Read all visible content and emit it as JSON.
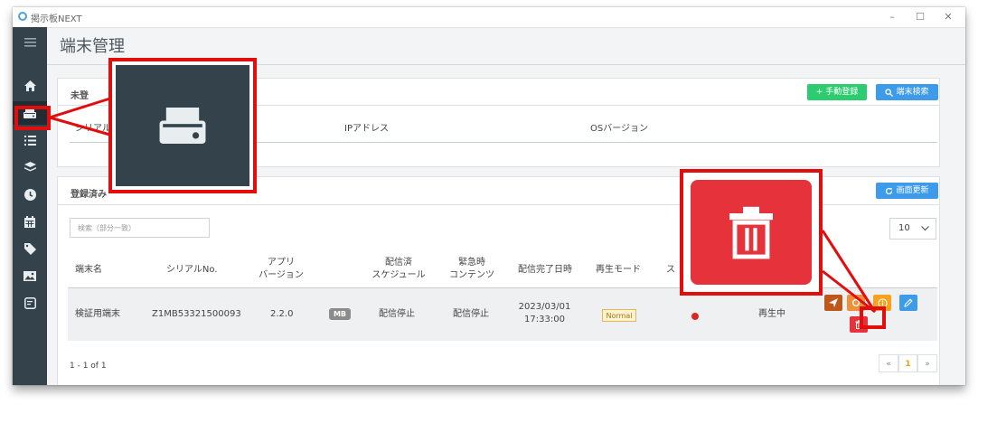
{
  "window": {
    "app_title": "掲示板NEXT",
    "controls": [
      "–",
      "☐",
      "✕"
    ]
  },
  "sidebar": {
    "items": [
      {
        "icon": "menu-icon",
        "active": false
      },
      {
        "icon": "home-icon",
        "active": false
      },
      {
        "icon": "terminal-device-icon",
        "active": true
      },
      {
        "icon": "list-icon",
        "active": false
      },
      {
        "icon": "layers-icon",
        "active": false
      },
      {
        "icon": "clock-icon",
        "active": false
      },
      {
        "icon": "calendar-icon",
        "active": false
      },
      {
        "icon": "tag-icon",
        "active": false
      },
      {
        "icon": "image-icon",
        "active": false
      },
      {
        "icon": "edit-note-icon",
        "active": false
      }
    ]
  },
  "page": {
    "title": "端末管理"
  },
  "unregistered": {
    "title": "未登",
    "manual_register_label": "+ 手動登録",
    "search_terminal_label": "端末検索",
    "columns": [
      "シリアル",
      "IPアドレス",
      "OSバージョン"
    ]
  },
  "registered": {
    "title": "登録済み",
    "refresh_label": "画面更新",
    "search_placeholder": "検索（部分一致）",
    "page_size": "10",
    "columns": {
      "name": "端末名",
      "serial": "シリアルNo.",
      "app_version_1": "アプリ",
      "app_version_2": "バージョン",
      "schedule_1": "配信済",
      "schedule_2": "スケジュール",
      "urgent_1": "緊急時",
      "urgent_2": "コンテンツ",
      "delivered_at": "配信完了日時",
      "play_mode": "再生モード",
      "status": "ス"
    },
    "rows": [
      {
        "name": "検証用端末",
        "serial": "Z1MB53321500093",
        "version": "2.2.0",
        "tag": "MB",
        "schedule": "配信停止",
        "urgent": "配信停止",
        "delivered_date": "2023/03/01",
        "delivered_time": "17:33:00",
        "mode": "Normal",
        "playback": "再生中"
      }
    ],
    "pagination_info": "1 - 1 of 1",
    "pagination": {
      "prev": "«",
      "current": "1",
      "next": "»"
    }
  },
  "colors": {
    "sidebar": "#34434b",
    "green_button": "#2ecc71",
    "blue_button": "#3d9be9",
    "delete_red": "#e6323a",
    "callout_red": "#e20e0e"
  }
}
